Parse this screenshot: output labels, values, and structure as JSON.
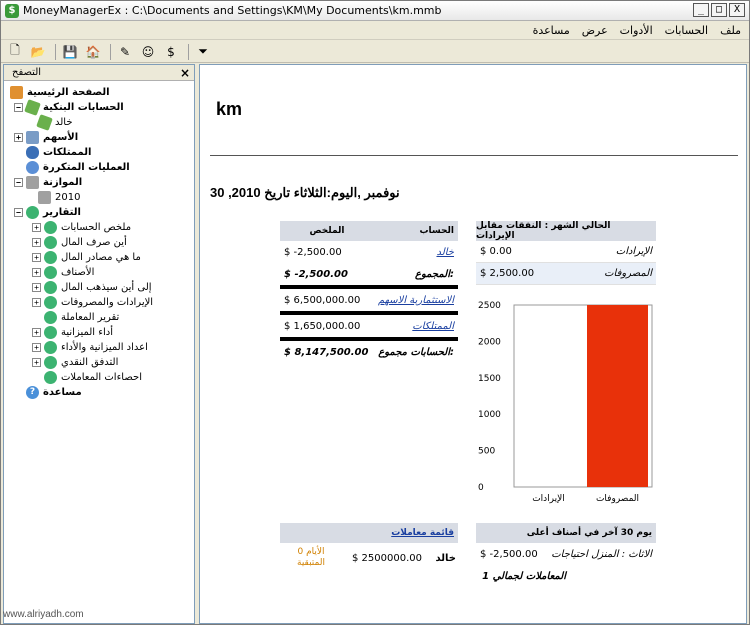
{
  "window": {
    "title": "MoneyManagerEx : C:\\Documents and Settings\\KM\\My Documents\\km.mmb",
    "app_icon_text": "$"
  },
  "controls": {
    "minimize": "_",
    "maximize": "□",
    "close": "X"
  },
  "menu": {
    "help": "مساعدة",
    "view": "عرض",
    "tools": "الأدوات",
    "accounts": "الحسابات",
    "file": "ملف"
  },
  "toolbar": {
    "new": "🗋",
    "open": "📂",
    "open_db": "💾",
    "home": "🏠",
    "edit": "✎",
    "categories": "☺",
    "payees": "$",
    "filter": "⏷"
  },
  "nav": {
    "title": "التصفح",
    "close": "×",
    "items": {
      "home": "الصفحة الرئيسية",
      "bank_accounts": "الحسابات البنكية",
      "khalid": "خالد",
      "stocks": "الأسهم",
      "assets": "الممتلكات",
      "recurring": "العمليات المتكررة",
      "budget": "الموازنة",
      "budget_2010": "2010",
      "reports": "التقارير",
      "r1": "ملخص الحسابات",
      "r2": "أين صرف المال",
      "r3": "ما هي مصادر المال",
      "r4": "الأصناف",
      "r5": "إلى أين سيذهب المال",
      "r6": "الإيرادات والمصروفات",
      "r7": "تقرير المعاملة",
      "r8": "أداء الميزانية",
      "r9": "اعداد الميزانية والأداء",
      "r10": "التدفق النقدي",
      "r11": "احصاءات المعاملات",
      "help": "مساعدة"
    }
  },
  "main": {
    "account_name": "km",
    "date_line": "30 ,2010 نوفمبر ,اليوم:الثلاثاء تاريخ",
    "accounts_table": {
      "col_account": "الحساب",
      "col_summary": "الملخص",
      "rows": {
        "khalid_name": "خالد",
        "khalid_value": "$ -2,500.00",
        "total_label": "المجموع:",
        "total_value": "$ -2,500.00",
        "stocks_name": "الاستثمارية الاسهم",
        "stocks_value": "$ 6,500,000.00",
        "assets_name": "الممتلكات",
        "assets_value": "$ 1,650,000.00",
        "grand_label": "الحسابات مجموع:",
        "grand_value": "$ 8,147,500.00"
      }
    },
    "income_table": {
      "header": "الحالي الشهر : النفقات مقابل الإيرادات",
      "income_label": "الإيرادات",
      "income_value": "$ 0.00",
      "expense_label": "المصروفات",
      "expense_value": "$ 2,500.00"
    },
    "transactions_table": {
      "header": "قائمة معاملات",
      "name": "خالد",
      "value": "$ 2500000.00",
      "note_line1": "الأيام 0",
      "note_line2": "المتبقية"
    },
    "top_table": {
      "header": "يوم 30 آخر في أصناف أعلى",
      "item_label": "الاثاث : المنزل احتياجات",
      "item_value": "$ -2,500.00",
      "count_line": "المعاملات لجمالي 1"
    }
  },
  "chart_data": {
    "type": "bar",
    "categories": [
      "الإيرادات",
      "المصروفات"
    ],
    "values": [
      0,
      2500
    ],
    "ylim": [
      0,
      2500
    ],
    "yticks": [
      "0",
      "500",
      "1000",
      "1500",
      "2000",
      "2500"
    ],
    "bar_color": "#e8310a"
  },
  "watermark": "www.alriyadh.com"
}
